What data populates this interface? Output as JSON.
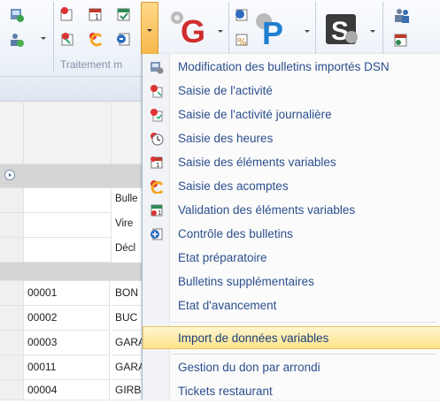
{
  "ribbon": {
    "group_label": "Traitement m",
    "icons": [
      "dsn-import-icon",
      "activity-entry-icon",
      "hours-entry-icon",
      "variable-elements-icon",
      "advance-payment-icon",
      "validation-icon",
      "bulletin-check-icon",
      "settings-gear-icon",
      "g-logo-icon",
      "p-logo-icon",
      "exchange-icon",
      "percent-icon",
      "s-gear-icon",
      "user-group-icon",
      "calendar-validate-icon"
    ]
  },
  "grid": {
    "rows_text": [
      {
        "code": "",
        "name": "Bulle"
      },
      {
        "code": "",
        "name": "Vire"
      },
      {
        "code": "",
        "name": "Décl"
      }
    ],
    "rows": [
      {
        "code": "00001",
        "name": "BON"
      },
      {
        "code": "00002",
        "name": "BUC"
      },
      {
        "code": "00003",
        "name": "GARA"
      },
      {
        "code": "00011",
        "name": "GARA"
      },
      {
        "code": "00004",
        "name": "GIRB"
      }
    ]
  },
  "menu": {
    "items": [
      {
        "label": "Modification des bulletins importés DSN",
        "icon": "dsn-modify-icon"
      },
      {
        "label": "Saisie de l'activité",
        "icon": "activity-entry-icon"
      },
      {
        "label": "Saisie de l'activité journalière",
        "icon": "daily-activity-icon"
      },
      {
        "label": "Saisie des heures",
        "icon": "hours-clock-icon"
      },
      {
        "label": "Saisie des éléments variables",
        "icon": "variable-elements-icon"
      },
      {
        "label": "Saisie des acomptes",
        "icon": "advance-payment-icon"
      },
      {
        "label": "Validation des éléments variables",
        "icon": "validation-icon"
      },
      {
        "label": "Contrôle des bulletins",
        "icon": "bulletin-check-icon"
      },
      {
        "label": "Etat préparatoire",
        "icon": ""
      },
      {
        "label": "Bulletins supplémentaires",
        "icon": ""
      },
      {
        "label": "Etat d'avancement",
        "icon": ""
      },
      {
        "label": "Import de données variables",
        "icon": ""
      },
      {
        "label": "Gestion du don par arrondi",
        "icon": ""
      },
      {
        "label": "Tickets restaurant",
        "icon": ""
      }
    ],
    "highlighted_index": 11,
    "highlight_color": "#ffe38a"
  }
}
